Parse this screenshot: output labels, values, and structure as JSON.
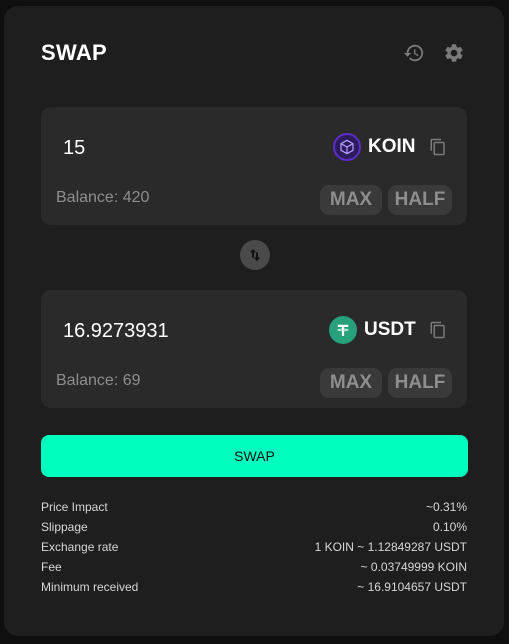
{
  "header": {
    "title": "SWAP",
    "history_icon": "history-icon",
    "settings_icon": "gear-icon"
  },
  "from": {
    "amount": "15",
    "token": "KOIN",
    "token_icon": "koin-logo",
    "balance": "Balance: 420",
    "max_label": "MAX",
    "half_label": "HALF"
  },
  "to": {
    "amount": "16.9273931",
    "token": "USDT",
    "token_icon": "usdt-logo",
    "balance": "Balance: 69",
    "max_label": "MAX",
    "half_label": "HALF"
  },
  "switch_icon": "swap-arrows-icon",
  "swap_button": "SWAP",
  "details": [
    {
      "label": "Price Impact",
      "value": "~0.31%"
    },
    {
      "label": "Slippage",
      "value": "0.10%"
    },
    {
      "label": "Exchange rate",
      "value": "1 KOIN ~ 1.12849287 USDT"
    },
    {
      "label": "Fee",
      "value": "~ 0.03749999 KOIN"
    },
    {
      "label": "Minimum received",
      "value": "~ 16.9104657 USDT"
    }
  ],
  "colors": {
    "accent": "#00ffbf",
    "card": "#1e1e1e",
    "panel": "#2a2a2a",
    "koin": "#6b3fd4",
    "usdt": "#26a17b"
  }
}
